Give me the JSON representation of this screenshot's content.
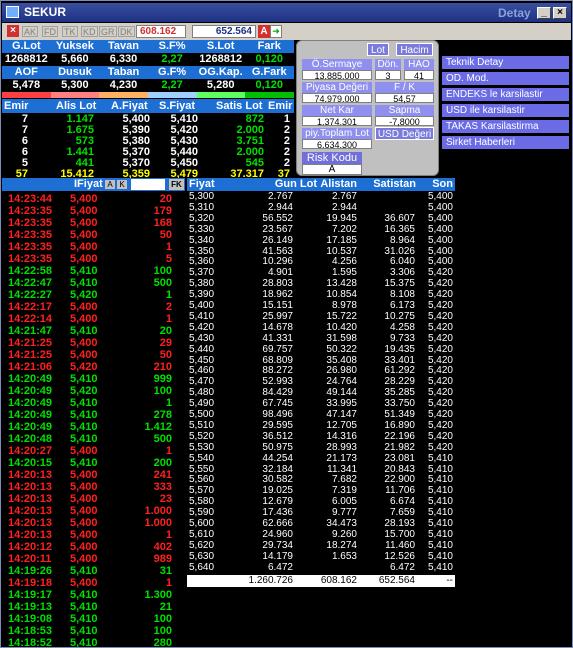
{
  "window": {
    "title": "SEKUR",
    "right_title": "Detay"
  },
  "toolbar": {
    "tabs": [
      "AK",
      "FD",
      "TK",
      "KD",
      "GR",
      "DK"
    ],
    "value1": "608.162",
    "value2": "652.564",
    "a_label": "A"
  },
  "summary": {
    "row1_headers": [
      "G.Lot",
      "Yuksek",
      "Tavan",
      "S.F%",
      "S.Lot",
      "Fark"
    ],
    "row1_values": [
      "1268812",
      "5,660",
      "6,330",
      "2,27",
      "1268812",
      "0,120"
    ],
    "row2_headers": [
      "AOF",
      "Dusuk",
      "Taban",
      "G.F%",
      "OG.Kap.",
      "G.Fark"
    ],
    "row2_values": [
      "5,478",
      "5,300",
      "4,230",
      "2,27",
      "5,280",
      "0,120"
    ]
  },
  "depth": {
    "headers": [
      "Emir",
      "Alis Lot",
      "A.Fiyat",
      "S.Fiyat",
      "Satis Lot",
      "Emir"
    ],
    "rows": [
      [
        "7",
        "1.147",
        "5,400",
        "5,410",
        "872",
        "1"
      ],
      [
        "7",
        "1.675",
        "5,390",
        "5,420",
        "2.000",
        "2"
      ],
      [
        "6",
        "573",
        "5,380",
        "5,430",
        "3.751",
        "2"
      ],
      [
        "6",
        "1.441",
        "5,370",
        "5,440",
        "2.000",
        "2"
      ],
      [
        "5",
        "441",
        "5,370",
        "5,450",
        "545",
        "2"
      ],
      [
        "57",
        "15.412",
        "5,359",
        "5,479",
        "37.317",
        "37"
      ]
    ]
  },
  "panel": {
    "lot_btn": "Lot",
    "hacim_btn": "Hacim",
    "o_sermaye_label": "Ö.Sermaye",
    "o_sermaye_value": "13.885.000",
    "don_label": "Dön.",
    "don_value": "3",
    "hao_label": "HAO",
    "hao_value": "41",
    "piyasa_label": "Piyasa Değeri",
    "piyasa_value": "74.979.000",
    "fk_label": "F / K",
    "fk_value": "54,57",
    "netkar_label": "Net Kar",
    "netkar_value": "1.374.301",
    "sapma_label": "Sapma",
    "sapma_value": "-7,8000",
    "piyasa_lot_label": "piy.Toplam Lot",
    "piyasa_lot_value": "6.634.300",
    "usd_label": "USD Değeri",
    "risk_label": "Risk Kodu",
    "risk_value": "A"
  },
  "menu": {
    "items": [
      "Teknik Detay",
      "OD. Mod.",
      "ENDEKS le karsilastir",
      "USD ile karsilastir",
      "TAKAS Karsilastirma",
      "Sirket Haberleri"
    ]
  },
  "trades": {
    "header_label": "IFiyat",
    "fk_label": "FK",
    "rows": [
      [
        "14:23:44",
        "5,400",
        "20",
        "r"
      ],
      [
        "14:23:35",
        "5,400",
        "179",
        "r"
      ],
      [
        "14:23:35",
        "5,400",
        "168",
        "r"
      ],
      [
        "14:23:35",
        "5,400",
        "50",
        "r"
      ],
      [
        "14:23:35",
        "5,400",
        "1",
        "r"
      ],
      [
        "14:23:35",
        "5,400",
        "5",
        "r"
      ],
      [
        "14:22:58",
        "5,410",
        "100",
        "g"
      ],
      [
        "14:22:47",
        "5,410",
        "500",
        "g"
      ],
      [
        "14:22:27",
        "5,420",
        "1",
        "g"
      ],
      [
        "14:22:17",
        "5,400",
        "2",
        "r"
      ],
      [
        "14:22:14",
        "5,400",
        "1",
        "r"
      ],
      [
        "14:21:47",
        "5,410",
        "20",
        "g"
      ],
      [
        "14:21:25",
        "5,400",
        "29",
        "r"
      ],
      [
        "14:21:25",
        "5,400",
        "50",
        "r"
      ],
      [
        "14:21:06",
        "5,420",
        "210",
        "r"
      ],
      [
        "14:20:49",
        "5,410",
        "999",
        "g"
      ],
      [
        "14:20:49",
        "5,420",
        "100",
        "g"
      ],
      [
        "14:20:49",
        "5,410",
        "1",
        "g"
      ],
      [
        "14:20:49",
        "5,410",
        "278",
        "g"
      ],
      [
        "14:20:49",
        "5,410",
        "1.412",
        "g"
      ],
      [
        "14:20:48",
        "5,410",
        "500",
        "g"
      ],
      [
        "14:20:27",
        "5,400",
        "1",
        "r"
      ],
      [
        "14:20:15",
        "5,410",
        "200",
        "g"
      ],
      [
        "14:20:13",
        "5,400",
        "241",
        "r"
      ],
      [
        "14:20:13",
        "5,400",
        "333",
        "r"
      ],
      [
        "14:20:13",
        "5,400",
        "23",
        "r"
      ],
      [
        "14:20:13",
        "5,400",
        "1.000",
        "r"
      ],
      [
        "14:20:13",
        "5,400",
        "1.000",
        "r"
      ],
      [
        "14:20:13",
        "5,400",
        "1",
        "r"
      ],
      [
        "14:20:12",
        "5,400",
        "402",
        "r"
      ],
      [
        "14:20:11",
        "5,400",
        "989",
        "r"
      ],
      [
        "14:19:26",
        "5,410",
        "31",
        "g"
      ],
      [
        "14:19:18",
        "5,400",
        "1",
        "r"
      ],
      [
        "14:19:17",
        "5,410",
        "1.300",
        "g"
      ],
      [
        "14:19:13",
        "5,410",
        "21",
        "g"
      ],
      [
        "14:19:08",
        "5,410",
        "100",
        "g"
      ],
      [
        "14:18:53",
        "5,410",
        "100",
        "g"
      ],
      [
        "14:18:52",
        "5,410",
        "280",
        "g"
      ]
    ]
  },
  "distribution": {
    "headers": [
      "Fiyat",
      "Gun Lot",
      "Alistan",
      "Satistan",
      "Son"
    ],
    "rows": [
      [
        "5,300",
        "2.767",
        "2.767",
        "",
        "5,400"
      ],
      [
        "5,310",
        "2.944",
        "2.944",
        "",
        "5,400"
      ],
      [
        "5,320",
        "56.552",
        "19.945",
        "36.607",
        "5,400"
      ],
      [
        "5,330",
        "23.567",
        "7.202",
        "16.365",
        "5,400"
      ],
      [
        "5,340",
        "26.149",
        "17.185",
        "8.964",
        "5,400"
      ],
      [
        "5,350",
        "41.563",
        "10.537",
        "31.026",
        "5,400"
      ],
      [
        "5,360",
        "10.296",
        "4.256",
        "6.040",
        "5,400"
      ],
      [
        "5,370",
        "4.901",
        "1.595",
        "3.306",
        "5,420"
      ],
      [
        "5,380",
        "28.803",
        "13.428",
        "15.375",
        "5,420"
      ],
      [
        "5,390",
        "18.962",
        "10.854",
        "8.108",
        "5,420"
      ],
      [
        "5,400",
        "15.151",
        "8.978",
        "6.173",
        "5,420"
      ],
      [
        "5,410",
        "25.997",
        "15.722",
        "10.275",
        "5,420"
      ],
      [
        "5,420",
        "14.678",
        "10.420",
        "4.258",
        "5,420"
      ],
      [
        "5,430",
        "41.331",
        "31.598",
        "9.733",
        "5,420"
      ],
      [
        "5,440",
        "69.757",
        "50.322",
        "19.435",
        "5,420"
      ],
      [
        "5,450",
        "68.809",
        "35.408",
        "33.401",
        "5,420"
      ],
      [
        "5,460",
        "88.272",
        "26.980",
        "61.292",
        "5,420"
      ],
      [
        "5,470",
        "52.993",
        "24.764",
        "28.229",
        "5,420"
      ],
      [
        "5,480",
        "84.429",
        "49.144",
        "35.285",
        "5,420"
      ],
      [
        "5,490",
        "67.745",
        "33.995",
        "33.750",
        "5,420"
      ],
      [
        "5,500",
        "98.496",
        "47.147",
        "51.349",
        "5,420"
      ],
      [
        "5,510",
        "29.595",
        "12.705",
        "16.890",
        "5,420"
      ],
      [
        "5,520",
        "36.512",
        "14.316",
        "22.196",
        "5,420"
      ],
      [
        "5,530",
        "50.975",
        "28.993",
        "21.982",
        "5,420"
      ],
      [
        "5,540",
        "44.254",
        "21.173",
        "23.081",
        "5,410"
      ],
      [
        "5,550",
        "32.184",
        "11.341",
        "20.843",
        "5,410"
      ],
      [
        "5,560",
        "30.582",
        "7.682",
        "22.900",
        "5,410"
      ],
      [
        "5,570",
        "19.025",
        "7.319",
        "11.706",
        "5,410"
      ],
      [
        "5,580",
        "12.679",
        "6.005",
        "6.674",
        "5,410"
      ],
      [
        "5,590",
        "17.436",
        "9.777",
        "7.659",
        "5,410"
      ],
      [
        "5,600",
        "62.666",
        "34.473",
        "28.193",
        "5,410"
      ],
      [
        "5,610",
        "24.960",
        "9.260",
        "15.700",
        "5,410"
      ],
      [
        "5,620",
        "29.734",
        "18.274",
        "11.460",
        "5,410"
      ],
      [
        "5,630",
        "14.179",
        "1.653",
        "12.526",
        "5,410"
      ],
      [
        "5,640",
        "6.472",
        "",
        "6.472",
        "5,410"
      ]
    ],
    "totals": [
      "1.260.726",
      "608.162",
      "652.564",
      "--"
    ]
  }
}
